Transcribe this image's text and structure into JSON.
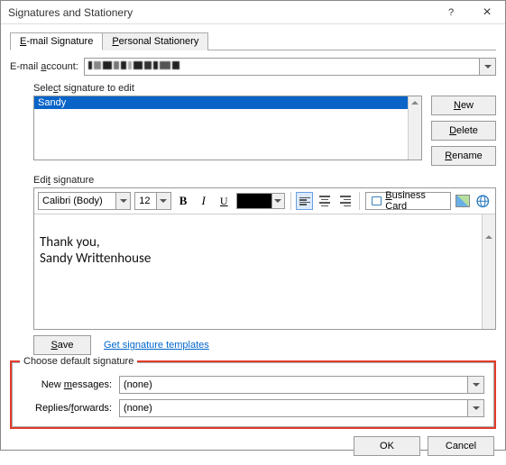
{
  "window": {
    "title": "Signatures and Stationery",
    "help": "?",
    "close": "×"
  },
  "tabs": {
    "email_u": "E",
    "email_rest": "-mail Signature",
    "personal_u": "P",
    "personal_rest": "ersonal Stationery"
  },
  "account": {
    "label_pre": "E-mail ",
    "label_u": "a",
    "label_post": "ccount:",
    "value": ""
  },
  "signatures": {
    "select_label_pre": "Sele",
    "select_label_u": "c",
    "select_label_post": "t signature to edit",
    "items": [
      "Sandy"
    ],
    "new_u": "N",
    "new_rest": "ew",
    "delete_u": "D",
    "delete_rest": "elete",
    "rename_u": "R",
    "rename_rest": "ename"
  },
  "editor": {
    "label_pre": "Edi",
    "label_u": "t",
    "label_post": " signature",
    "font": "Calibri (Body)",
    "size": "12",
    "content": "Thank you,\nSandy Writtenhouse",
    "save_u": "S",
    "save_rest": "ave",
    "templates_link": "Get signature templates",
    "biz_u": "B",
    "biz_rest": "usiness Card"
  },
  "defaults": {
    "legend": "Choose default signature",
    "new_label_pre": "New ",
    "new_label_u": "m",
    "new_label_post": "essages:",
    "new_value": "(none)",
    "replies_label_pre": "Replies/",
    "replies_label_u": "f",
    "replies_label_post": "orwards:",
    "replies_value": "(none)"
  },
  "footer": {
    "ok": "OK",
    "cancel": "Cancel"
  }
}
